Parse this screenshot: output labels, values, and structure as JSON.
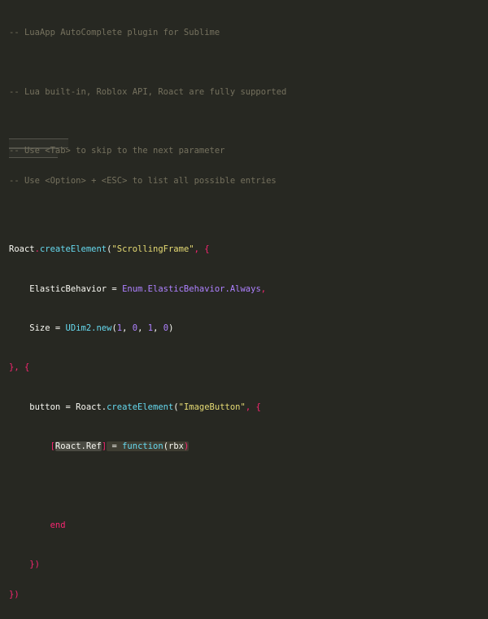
{
  "comments": {
    "c1": "-- LuaApp AutoComplete plugin for Sublime",
    "c2": "-- Lua built-in, Roblox API, Roact are fully supported",
    "c3": "-- Use <Tab> to skip to the next parameter",
    "c4": "-- Use <Option> + <ESC> to list all possible entries"
  },
  "code": {
    "l6_obj": "Roact",
    "l6_dot": ".",
    "l6_fn": "createElement",
    "l6_open": "(",
    "l6_str": "\"ScrollingFrame\"",
    "l6_rest": ", {",
    "l7_key": "    ElasticBehavior = ",
    "l7_enum": "Enum.ElasticBehavior.Always",
    "l7_comma": ",",
    "l8_key": "    Size = ",
    "l8_fn": "UDim2.new",
    "l8_open": "(",
    "l8_n1": "1",
    "l8_s1": ", ",
    "l8_n2": "0",
    "l8_s2": ", ",
    "l8_n3": "1",
    "l8_s3": ", ",
    "l8_n4": "0",
    "l8_close": ")",
    "l9_close": "}, {",
    "l10_key": "    button = Roact.",
    "l10_fn": "createElement",
    "l10_open": "(",
    "l10_str": "\"ImageButton\"",
    "l10_rest": ", {",
    "l11_indent": "        ",
    "l11_open": "[",
    "l11_ref": "Roact.Ref",
    "l11_close": "]",
    "l11_eq": " = ",
    "l11_fn": "function",
    "l11_paren": "(",
    "l11_arg": "rbx",
    "l11_rparen": ")",
    "l13_indent": "        ",
    "l13_end": "end",
    "l14": "    })",
    "l15": "})"
  }
}
